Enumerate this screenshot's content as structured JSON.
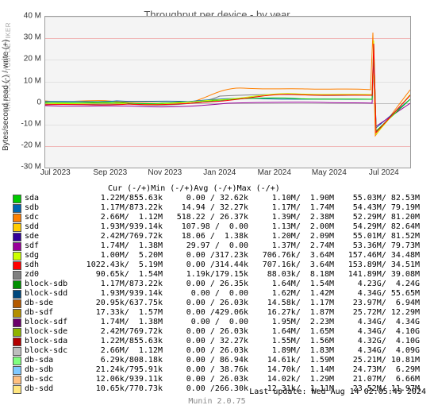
{
  "title": "Throughput per device - by year",
  "ylabel": "Bytes/second read (-) / write (+)",
  "side_brand": "RRDTOOL / TOBI OETIKER",
  "footer": "Munin 2.0.75",
  "last_update": "Last update: Wed Aug 14 02:05:49 2024",
  "chart_data": {
    "type": "line",
    "x_categories": [
      "Jul 2023",
      "Sep 2023",
      "Nov 2023",
      "Jan 2024",
      "Mar 2024",
      "May 2024",
      "Jul 2024"
    ],
    "y_ticks": [
      -30,
      -20,
      -10,
      0,
      10,
      20,
      30,
      40
    ],
    "y_tick_labels": [
      "-30 M",
      "-20 M",
      "-10 M",
      "0",
      "10 M",
      "20 M",
      "30 M",
      "40 M"
    ],
    "ylim": [
      -30,
      40
    ],
    "legend_columns": [
      "Cur (-/+)",
      "Min (-/+)",
      "Avg (-/+)",
      "Max (-/+)"
    ],
    "series": [
      {
        "name": "sda",
        "color": "#00cc00",
        "cur": "1.22M/855.63k",
        "min": "0.00 / 32.62k",
        "avg": "1.10M/  1.90M",
        "max": "55.03M/ 82.53M"
      },
      {
        "name": "sdb",
        "color": "#0066b3",
        "cur": "1.17M/873.22k",
        "min": "14.94 / 32.27k",
        "avg": "1.17M/  1.74M",
        "max": "54.43M/ 79.19M"
      },
      {
        "name": "sdc",
        "color": "#ff8000",
        "cur": "2.66M/  1.12M",
        "min": "518.22 / 26.37k",
        "avg": "1.39M/  2.38M",
        "max": "52.29M/ 81.20M"
      },
      {
        "name": "sdd",
        "color": "#ffcc00",
        "cur": "1.93M/939.14k",
        "min": "107.98 /  0.00",
        "avg": "1.13M/  2.00M",
        "max": "54.29M/ 82.64M"
      },
      {
        "name": "sde",
        "color": "#330099",
        "cur": "2.42M/769.72k",
        "min": "18.06 /  1.38k",
        "avg": "1.20M/  2.09M",
        "max": "55.01M/ 81.52M"
      },
      {
        "name": "sdf",
        "color": "#990099",
        "cur": "1.74M/  1.38M",
        "min": "29.97 /  0.00",
        "avg": "1.37M/  2.74M",
        "max": "53.36M/ 79.73M"
      },
      {
        "name": "sdg",
        "color": "#ccff00",
        "cur": "1.00M/  5.20M",
        "min": "0.00 /317.23k",
        "avg": "706.76k/  3.64M",
        "max": "157.46M/ 34.48M"
      },
      {
        "name": "sdh",
        "color": "#ff0000",
        "cur": "1022.43k/  5.19M",
        "min": "0.00 /314.44k",
        "avg": "707.16k/  3.64M",
        "max": "153.89M/ 34.51M"
      },
      {
        "name": "zd0",
        "color": "#808080",
        "cur": "90.65k/  1.54M",
        "min": "1.19k/179.15k",
        "avg": "88.03k/  8.18M",
        "max": "141.89M/ 39.08M"
      },
      {
        "name": "block-sdb",
        "color": "#008f00",
        "cur": "1.17M/873.22k",
        "min": "0.00 / 26.35k",
        "avg": "1.64M/  1.54M",
        "max": "4.23G/  4.24G"
      },
      {
        "name": "block-sdd",
        "color": "#00487d",
        "cur": "1.93M/939.14k",
        "min": "0.00 /  0.00",
        "avg": "1.62M/  1.42M",
        "max": "4.34G/ 55.65M"
      },
      {
        "name": "db-sde",
        "color": "#b35a00",
        "cur": "20.95k/637.75k",
        "min": "0.00 / 26.03k",
        "avg": "14.58k/  1.17M",
        "max": "23.97M/  6.94M"
      },
      {
        "name": "db-sdf",
        "color": "#b38f00",
        "cur": "17.33k/  1.57M",
        "min": "0.00 /429.06k",
        "avg": "16.27k/  1.87M",
        "max": "25.72M/ 12.29M"
      },
      {
        "name": "block-sdf",
        "color": "#6b006b",
        "cur": "1.74M/  1.38M",
        "min": "0.00 /  0.00",
        "avg": "1.95M/  2.23M",
        "max": "4.34G/  4.34G"
      },
      {
        "name": "block-sde",
        "color": "#8fb300",
        "cur": "2.42M/769.72k",
        "min": "0.00 / 26.03k",
        "avg": "1.64M/  1.65M",
        "max": "4.34G/  4.10G"
      },
      {
        "name": "block-sda",
        "color": "#b30000",
        "cur": "1.22M/855.63k",
        "min": "0.00 / 32.27k",
        "avg": "1.55M/  1.56M",
        "max": "4.32G/  4.10G"
      },
      {
        "name": "block-sdc",
        "color": "#bebebe",
        "cur": "2.66M/  1.12M",
        "min": "0.00 / 26.03k",
        "avg": "1.89M/  1.83M",
        "max": "4.34G/  4.09G"
      },
      {
        "name": "db-sda",
        "color": "#80ff80",
        "cur": "6.29k/808.18k",
        "min": "0.00 / 86.94k",
        "avg": "14.61k/  1.59M",
        "max": "25.21M/ 10.81M"
      },
      {
        "name": "db-sdb",
        "color": "#80c9ff",
        "cur": "21.24k/795.91k",
        "min": "0.00 / 38.76k",
        "avg": "14.70k/  1.14M",
        "max": "24.73M/  6.29M"
      },
      {
        "name": "db-sdc",
        "color": "#ffc080",
        "cur": "12.06k/939.11k",
        "min": "0.00 / 26.03k",
        "avg": "14.02k/  1.29M",
        "max": "21.07M/  6.66M"
      },
      {
        "name": "db-sdd",
        "color": "#ffe680",
        "cur": "10.65k/770.73k",
        "min": "0.00 /266.30k",
        "avg": "12.31k/  1.11M",
        "max": "23.52M/ 11.97M"
      }
    ],
    "_note": "Series time-points are aggregate (cur/min/avg/max) from RRD graph legend — pixel traces in plot are approximate."
  }
}
